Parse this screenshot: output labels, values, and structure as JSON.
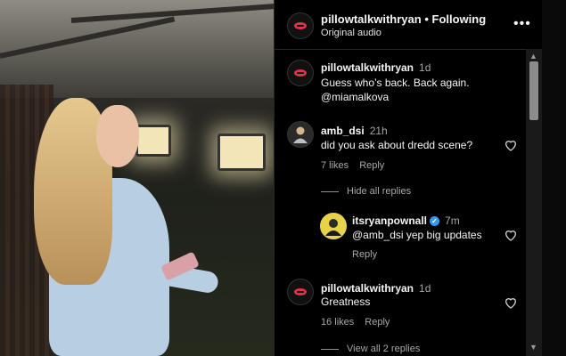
{
  "header": {
    "username": "pillowtalkwithryan",
    "separator": "•",
    "follow_status": "Following",
    "audio": "Original audio",
    "more_icon": "more-horizontal-icon"
  },
  "comments": [
    {
      "username": "pillowtalkwithryan",
      "time": "1d",
      "lines": [
        "Guess who’s back. Back again.",
        "@miamalkova"
      ]
    },
    {
      "username": "amb_dsi",
      "time": "21h",
      "text": "did you ask about dredd scene?",
      "likes": "7 likes",
      "reply": "Reply",
      "hide_replies": "Hide all replies",
      "replies": [
        {
          "username": "itsryanpownall",
          "verified": true,
          "time": "7m",
          "text": "@amb_dsi yep big updates",
          "reply": "Reply"
        }
      ]
    },
    {
      "username": "pillowtalkwithryan",
      "time": "1d",
      "text": "Greatness",
      "likes": "16 likes",
      "reply": "Reply",
      "view_replies": "View all 2 replies"
    }
  ],
  "scrollbar": {
    "up_icon": "chevron-up-icon",
    "down_icon": "chevron-down-icon"
  },
  "colors": {
    "background": "#000000",
    "secondary_text": "#a8a8a8",
    "verified": "#3897f0",
    "lips": "#e2324a"
  }
}
